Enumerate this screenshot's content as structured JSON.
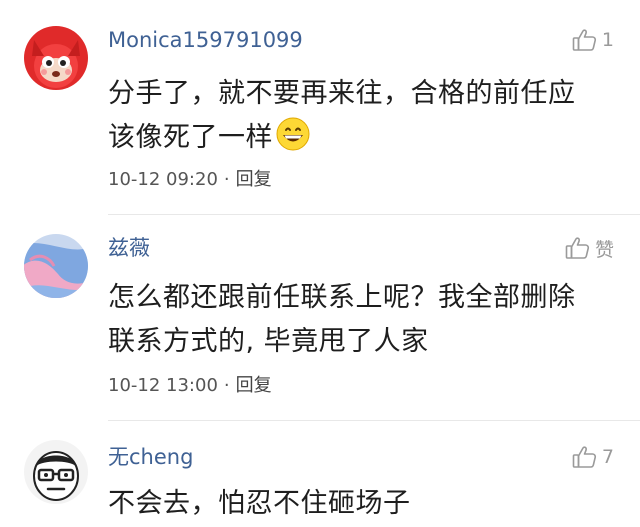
{
  "comments": [
    {
      "username": "Monica159791099",
      "like_count": "1",
      "content_line1": "分手了，就不要再来往，合格的前任应",
      "content_line2": "该像死了一样",
      "time": "10-12 09:20",
      "separator": "·",
      "reply_label": "回复",
      "avatar": "red-cartoon-cat-avatar",
      "emoji": "grinning-face-emoji"
    },
    {
      "username": "兹薇",
      "like_count": "赞",
      "content_line1": "怎么都还跟前任联系上呢？我全部删除",
      "content_line2": "联系方式的, 毕竟甩了人家",
      "time": "10-12 13:00",
      "separator": "·",
      "reply_label": "回复",
      "avatar": "pink-blue-abstract-avatar"
    },
    {
      "username": "无cheng",
      "like_count": "7",
      "content_line1": "不会去，怕忍不住砸场子",
      "avatar": "glasses-face-avatar"
    }
  ],
  "colors": {
    "username": "#3f6194",
    "text": "#1e1e1e",
    "meta": "#555555",
    "like": "#9a9a9a"
  }
}
